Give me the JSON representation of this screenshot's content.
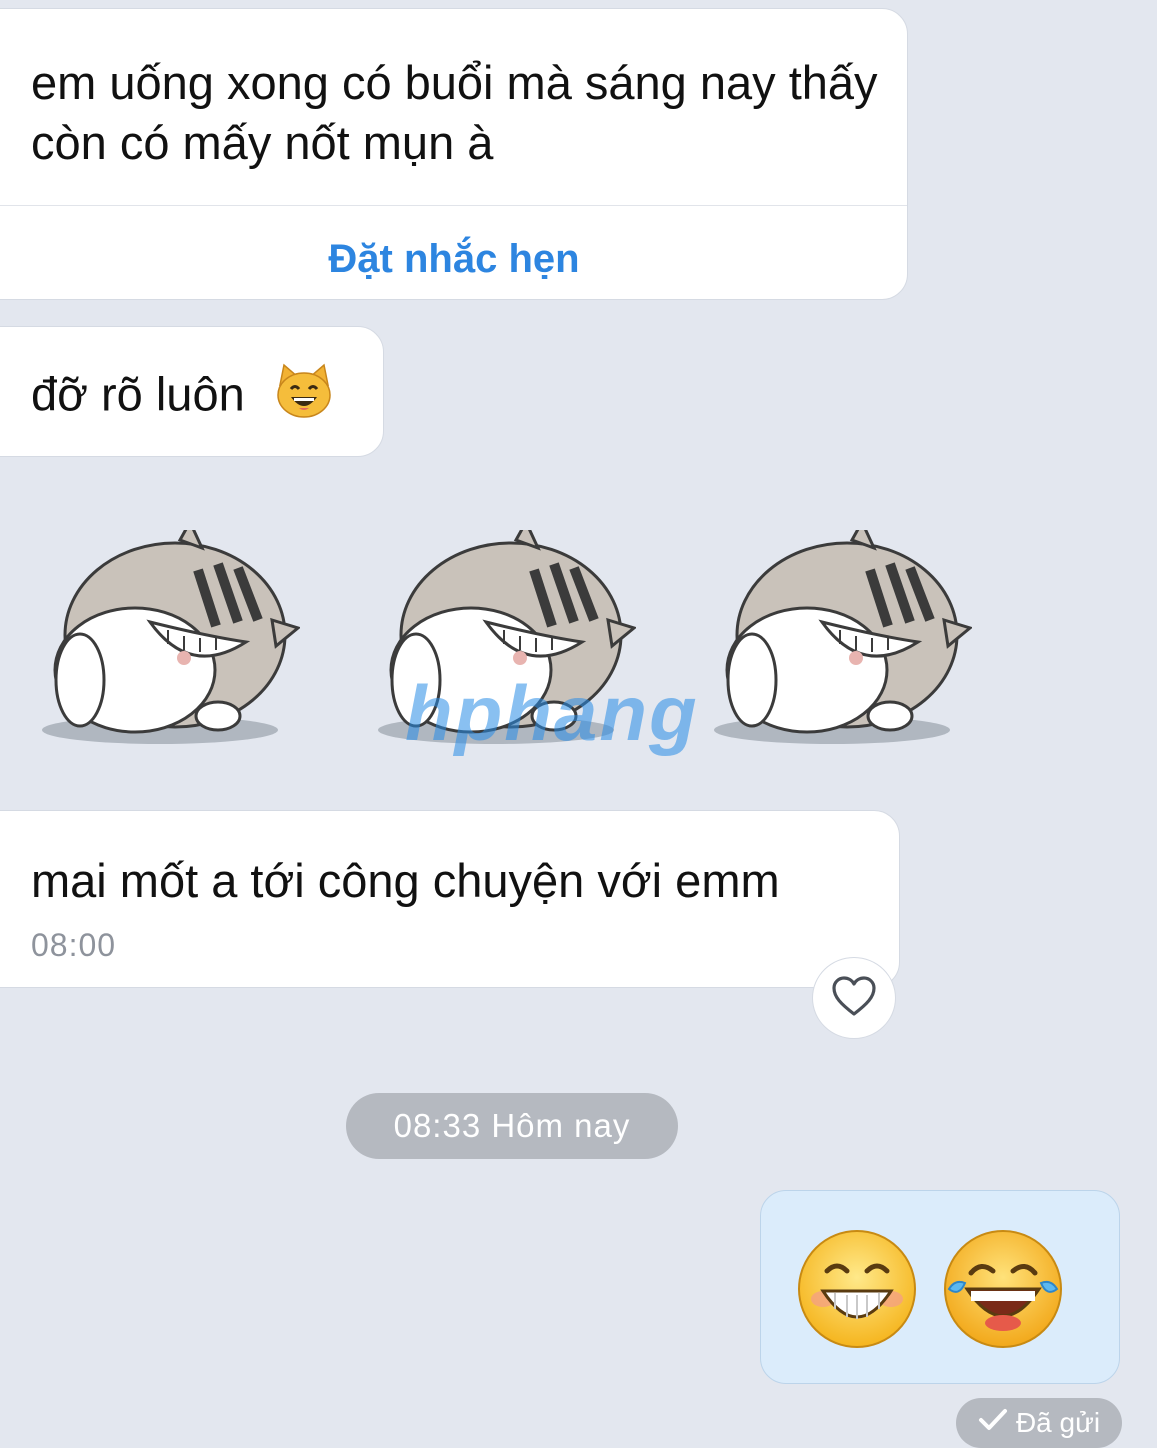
{
  "messages": [
    {
      "text": "em uống xong có buổi mà sáng nay thấy còn có mấy nốt mụn à",
      "action_label": "Đặt nhắc hẹn"
    },
    {
      "text": "đỡ rõ luôn",
      "emoji": "smiling-cat-icon"
    },
    {
      "stickers": [
        "laughing-cat-sticker",
        "laughing-cat-sticker",
        "laughing-cat-sticker"
      ]
    },
    {
      "text": "mai mốt a tới công chuyện với emm",
      "time": "08:00",
      "reaction_icon": "heart-icon"
    }
  ],
  "date_separator": "08:33 Hôm nay",
  "outgoing": {
    "emojis": [
      "grinning-face-icon",
      "tears-of-joy-icon"
    ],
    "status": "Đã gửi",
    "status_icon": "check-icon"
  },
  "watermark": "hphang",
  "colors": {
    "background": "#e3e7ef",
    "incoming_bubble": "#ffffff",
    "outgoing_bubble": "#dbecfb",
    "action_blue": "#2d85e0",
    "pill_gray": "#b5b9c0"
  }
}
